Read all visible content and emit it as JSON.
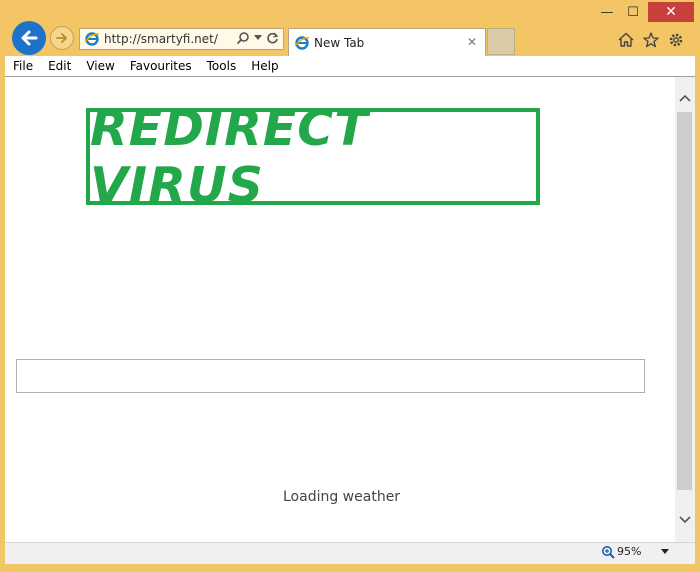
{
  "window": {
    "min_glyph": "—",
    "max_glyph": "☐",
    "close_glyph": "✕"
  },
  "browser": {
    "address": "http://smartyfi.net/",
    "tab_title": "New Tab",
    "tab_close": "✕"
  },
  "menu": [
    "File",
    "Edit",
    "View",
    "Favourites",
    "Tools",
    "Help"
  ],
  "page": {
    "logo_text": "REDIRECT VIRUS",
    "search_value": "",
    "weather_text": "Loading weather"
  },
  "status": {
    "zoom": "95%"
  },
  "colors": {
    "accent_green": "#22a84a",
    "frame": "#f3c565",
    "back_button": "#1c73c9"
  }
}
